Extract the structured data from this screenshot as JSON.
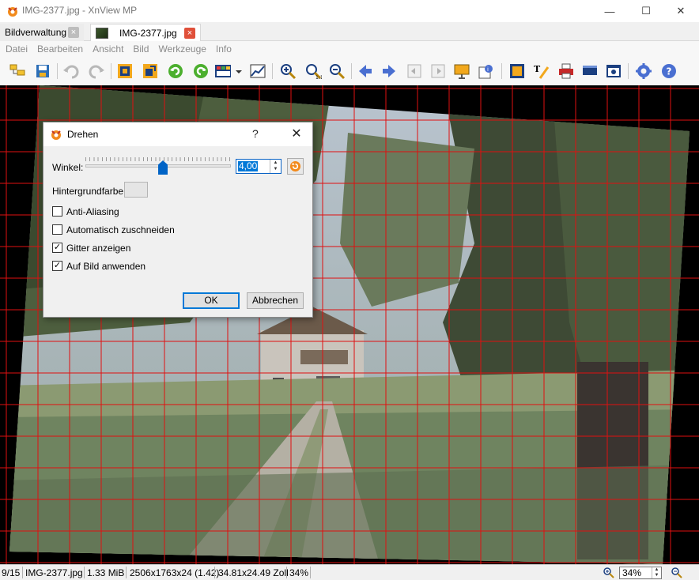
{
  "window": {
    "title": "IMG-2377.jpg - XnView MP",
    "minimize": "—",
    "maximize": "☐",
    "close": "✕"
  },
  "tabs": [
    {
      "label": "Bildverwaltung",
      "close": "×"
    },
    {
      "label": "IMG-2377.jpg",
      "close": "×"
    }
  ],
  "menu": [
    "Datei",
    "Bearbeiten",
    "Ansicht",
    "Bild",
    "Werkzeuge",
    "Info"
  ],
  "toolbar_icons": [
    "folder-tree-icon",
    "save-icon",
    "undo-icon",
    "redo-icon",
    "crop-icon",
    "resize-icon",
    "rotate-left-icon",
    "rotate-right-icon",
    "color-adjust-icon",
    "levels-icon",
    "zoom-in-icon",
    "zoom-actual-icon",
    "zoom-out-icon",
    "prev-icon",
    "next-icon",
    "first-page-icon",
    "last-page-icon",
    "slideshow-icon",
    "properties-icon",
    "fit-window-icon",
    "text-icon",
    "print-icon",
    "scanner-icon",
    "capture-icon",
    "settings-icon",
    "help-icon"
  ],
  "dialog": {
    "title": "Drehen",
    "help": "?",
    "close": "✕",
    "angle_label": "Winkel:",
    "angle_value": "4,00",
    "angle_slider": {
      "min": -180,
      "max": 180,
      "value": 4
    },
    "background_label": "Hintergrundfarbe",
    "background_color": "#e5e5e5",
    "options": [
      {
        "label": "Anti-Aliasing",
        "checked": false
      },
      {
        "label": "Automatisch zuschneiden",
        "checked": false
      },
      {
        "label": "Gitter anzeigen",
        "checked": true
      },
      {
        "label": "Auf Bild anwenden",
        "checked": true
      }
    ],
    "ok": "OK",
    "cancel": "Abbrechen"
  },
  "status": {
    "position": "9/15",
    "filename": "IMG-2377.jpg",
    "filesize": "1.33 MiB",
    "dimensions": "2506x1763x24 (1.42)",
    "print_size": "34.81x24.49 Zoll",
    "zoom": "34%",
    "zoom_field": "34%"
  },
  "colors": {
    "grid": "#e01010",
    "accent": "#0078d7",
    "tab_close": "#e0503a"
  }
}
